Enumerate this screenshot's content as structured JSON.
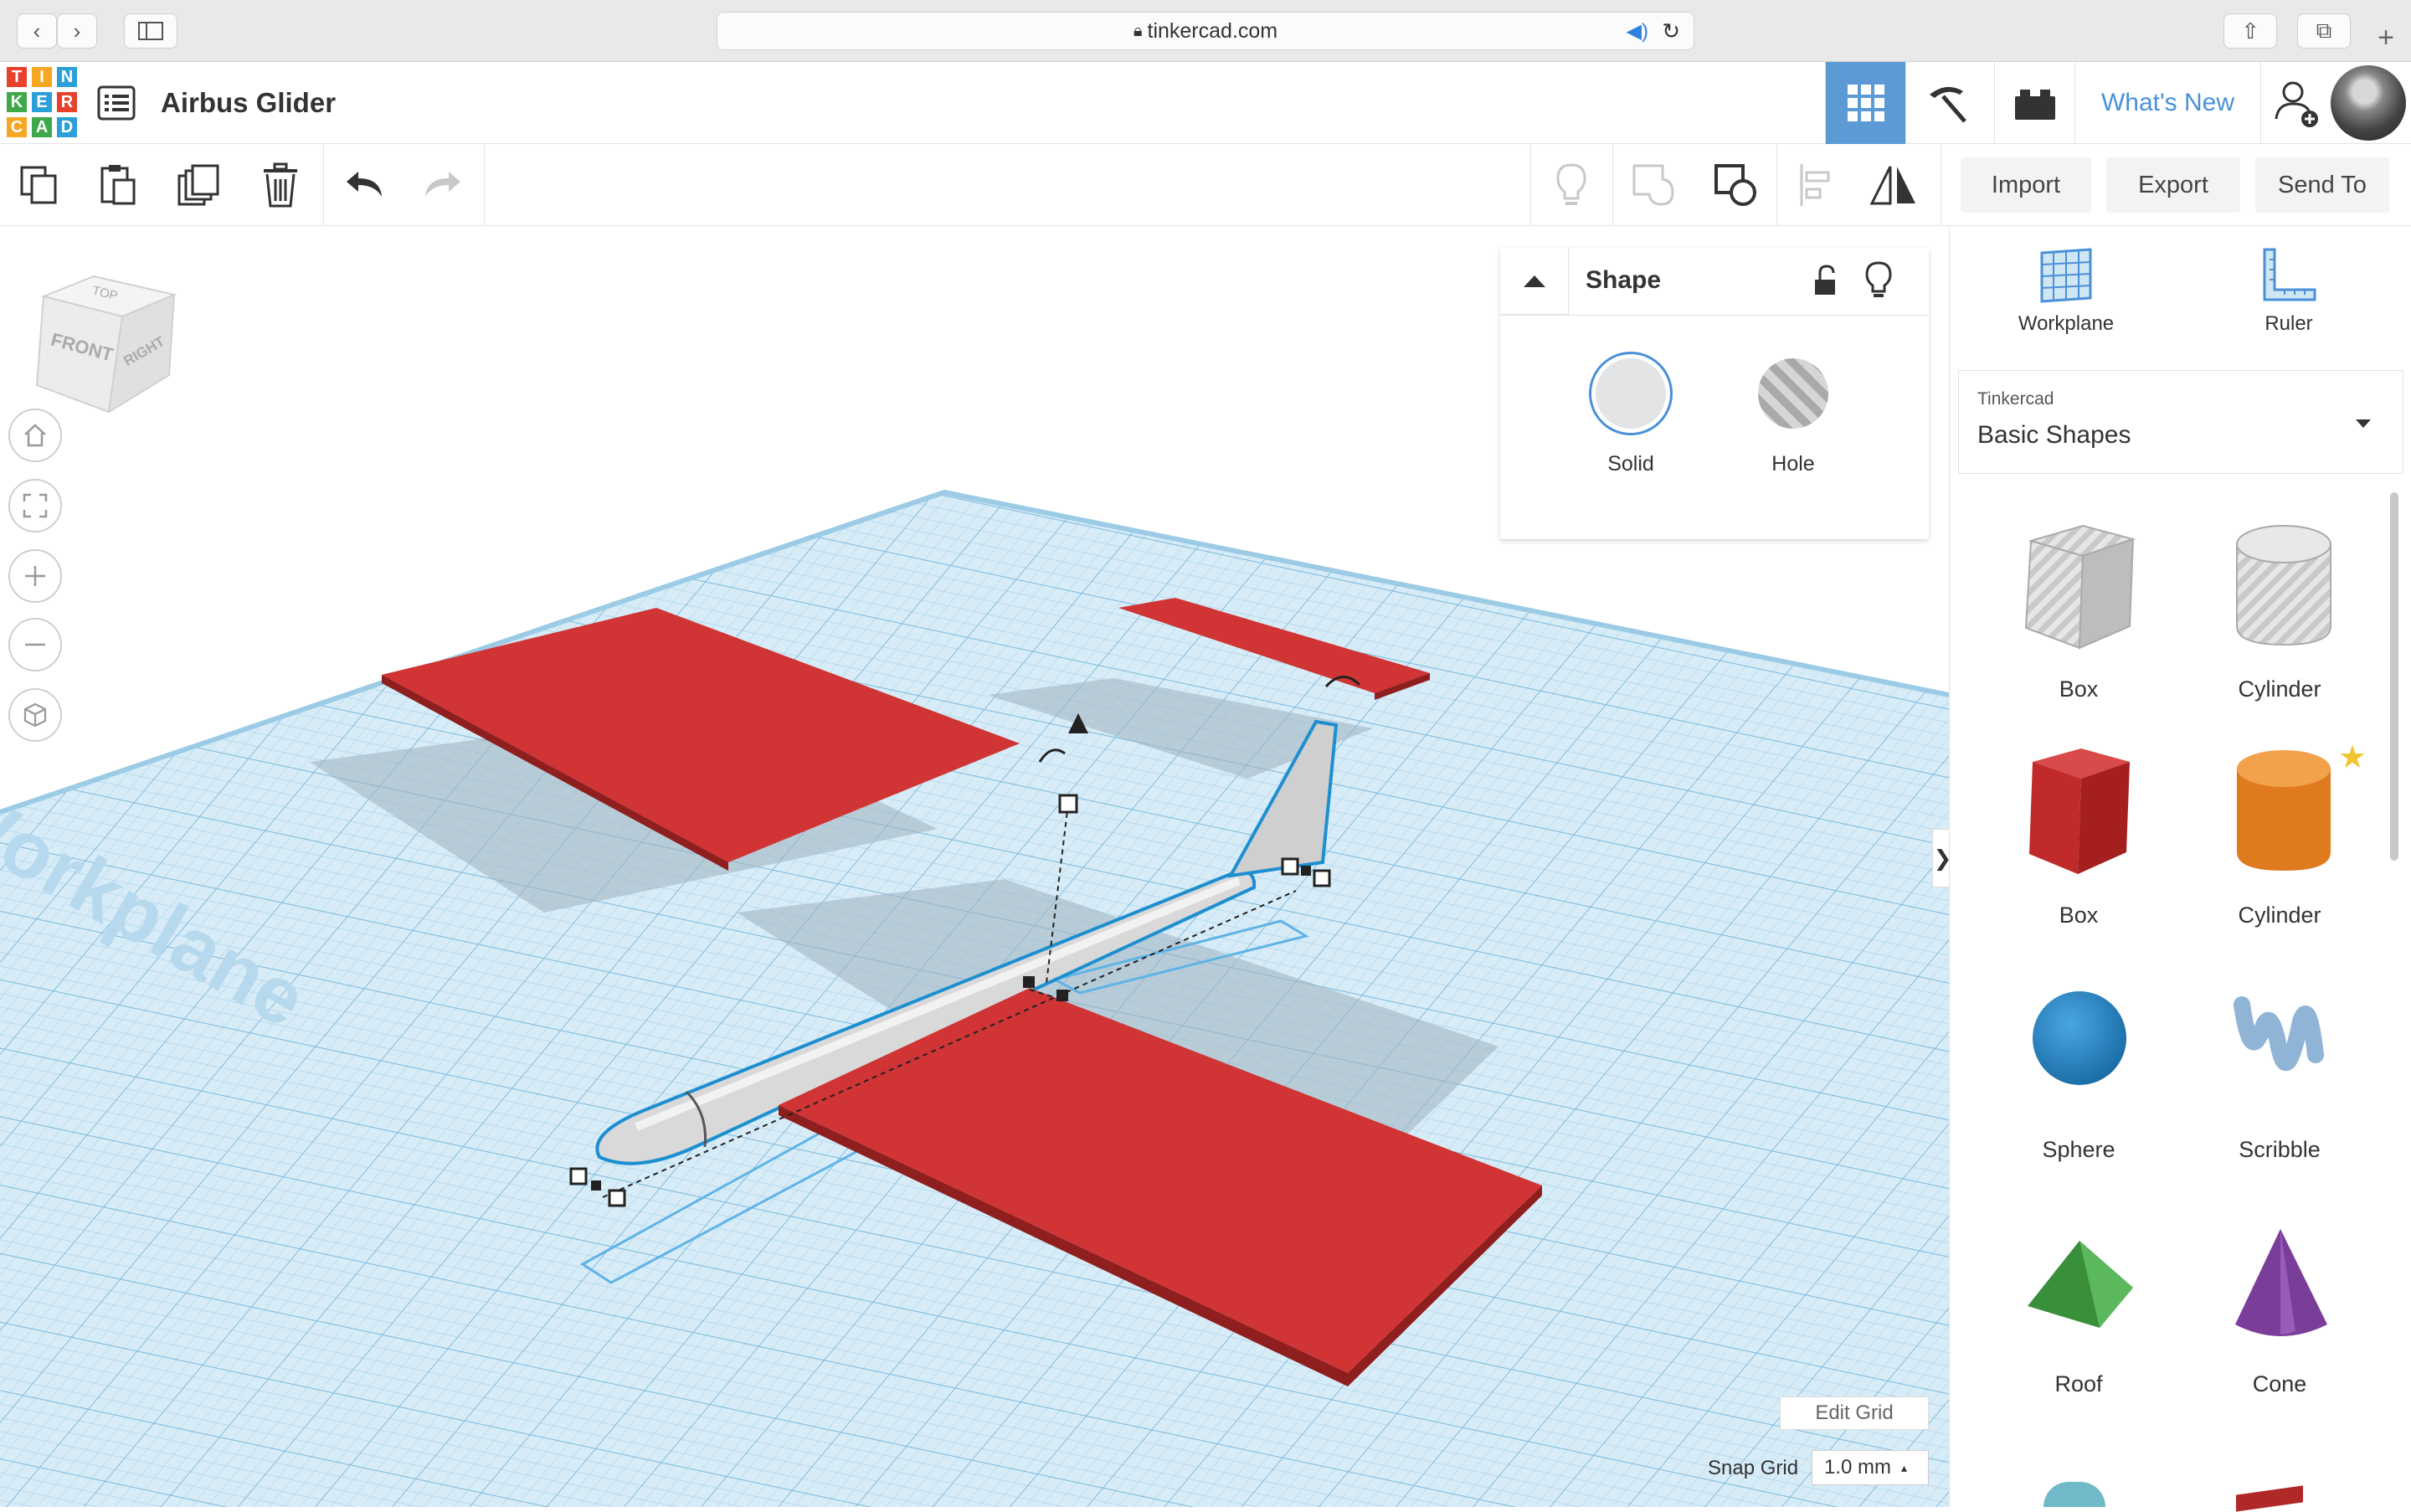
{
  "browser": {
    "url": "tinkercad.com"
  },
  "header": {
    "logo_letters": [
      "T",
      "I",
      "N",
      "K",
      "E",
      "R",
      "C",
      "A",
      "D"
    ],
    "design_title": "Airbus Glider",
    "whats_new": "What's New"
  },
  "toolbar": {
    "import_label": "Import",
    "export_label": "Export",
    "send_to_label": "Send To"
  },
  "viewcube": {
    "top": "TOP",
    "front": "FRONT",
    "right": "RIGHT"
  },
  "viewport": {
    "workplane_watermark": "Workplane",
    "edit_grid": "Edit Grid",
    "snap_grid_label": "Snap Grid",
    "snap_grid_value": "1.0 mm"
  },
  "shape_panel": {
    "title": "Shape",
    "solid_label": "Solid",
    "hole_label": "Hole"
  },
  "sidebar": {
    "workplane_label": "Workplane",
    "ruler_label": "Ruler",
    "library_provider": "Tinkercad",
    "library_name": "Basic Shapes",
    "shapes": [
      {
        "label": "Box",
        "icon": "box-hole-icon"
      },
      {
        "label": "Cylinder",
        "icon": "cylinder-hole-icon"
      },
      {
        "label": "Box",
        "icon": "box-solid-icon"
      },
      {
        "label": "Cylinder",
        "icon": "cylinder-solid-icon"
      },
      {
        "label": "Sphere",
        "icon": "sphere-icon"
      },
      {
        "label": "Scribble",
        "icon": "scribble-icon"
      },
      {
        "label": "Roof",
        "icon": "roof-icon"
      },
      {
        "label": "Cone",
        "icon": "cone-icon"
      }
    ]
  },
  "colors": {
    "accent_blue": "#4a90d9",
    "active_tab": "#5b9ad5",
    "wing_red": "#d03434",
    "workplane_blue": "#cfe6f3",
    "logo": [
      "#e8412b",
      "#f6a623",
      "#2a9fd8",
      "#3ea84a",
      "#2a9fd8",
      "#e8412b",
      "#f6a623",
      "#3ea84a",
      "#2a9fd8"
    ]
  }
}
